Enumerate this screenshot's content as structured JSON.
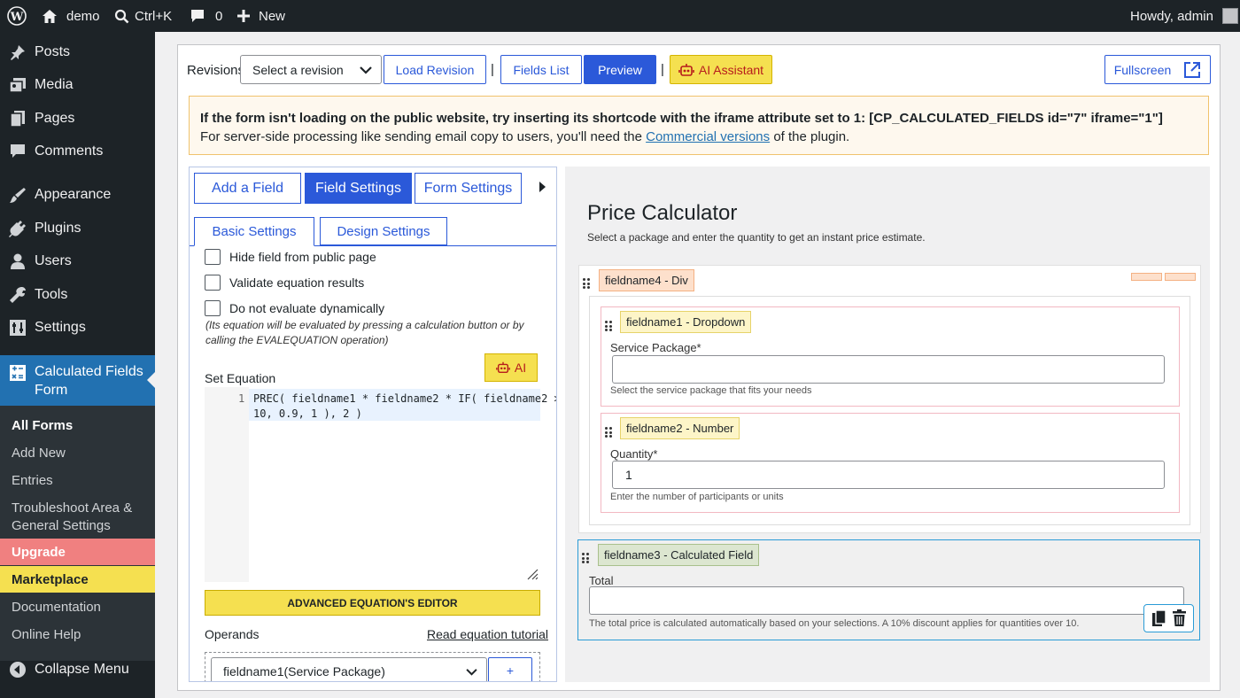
{
  "adminbar": {
    "site_name": "demo",
    "search_shortcut": "Ctrl+K",
    "comments_count": "0",
    "new_label": "New",
    "greeting": "Howdy, admin",
    "icons": [
      "wordpress-logo-icon",
      "home-icon",
      "search-icon",
      "comment-icon",
      "plus-icon",
      "avatar"
    ]
  },
  "sidebar": {
    "menu": [
      {
        "label": "Posts",
        "icon": "pushpin-icon"
      },
      {
        "label": "Media",
        "icon": "media-icon"
      },
      {
        "label": "Pages",
        "icon": "pages-icon"
      },
      {
        "label": "Comments",
        "icon": "comment-icon"
      },
      {
        "label": "Appearance",
        "icon": "brush-icon"
      },
      {
        "label": "Plugins",
        "icon": "plug-icon"
      },
      {
        "label": "Users",
        "icon": "user-icon"
      },
      {
        "label": "Tools",
        "icon": "wrench-icon"
      },
      {
        "label": "Settings",
        "icon": "sliders-icon"
      }
    ],
    "active": {
      "label_1": "Calculated Fields",
      "label_2": "Form",
      "icon": "calculator-icon"
    },
    "submenu": {
      "all_forms": "All Forms",
      "add_new": "Add New",
      "entries": "Entries",
      "troubleshoot_1": "Troubleshoot Area &",
      "troubleshoot_2": "General Settings",
      "upgrade": "Upgrade",
      "marketplace": "Marketplace",
      "documentation": "Documentation",
      "online_help": "Online Help"
    },
    "collapse": "Collapse Menu",
    "colors": {
      "active_bg": "#2271b1",
      "upgrade_bg": "#f08080",
      "marketplace_bg": "#f5e050"
    }
  },
  "toolbar": {
    "revisions_label": "Revisions",
    "revision_select": "Select a revision",
    "load_revision": "Load Revision",
    "separator": "|",
    "fields_list": "Fields List",
    "preview": "Preview",
    "ai_assistant": "AI Assistant",
    "fullscreen": "Fullscreen"
  },
  "notice": {
    "line1": "If the form isn't loading on the public website, try inserting its shortcode with the iframe attribute set to 1: [CP_CALCULATED_FIELDS id=\"7\" iframe=\"1\"]",
    "line2_before": "For server-side processing like sending email copy to users, you'll need the ",
    "line2_link": "Commercial versions",
    "line2_after": " of the plugin."
  },
  "editor": {
    "tabs": [
      "Add a Field",
      "Field Settings",
      "Form Settings"
    ],
    "subtabs": [
      "Basic Settings",
      "Design Settings"
    ],
    "hide_field": "Hide field from public page",
    "validate": "Validate equation results",
    "no_eval": "Do not evaluate dynamically",
    "no_eval_note_1": "(Its equation will be evaluated by pressing a calculation button or by",
    "no_eval_note_2": "calling the EVALEQUATION operation)",
    "ai_button": "AI",
    "set_equation": "Set Equation",
    "line_number": "1",
    "code_line_1": "PREC( fieldname1 * fieldname2 * IF( fieldname2 >",
    "code_line_2": "10, 0.9, 1 ), 2 )",
    "advanced_editor": "ADVANCED EQUATION'S EDITOR",
    "operands_label": "Operands",
    "tutorial_link": "Read equation tutorial",
    "operand_select": "fieldname1(Service Package)",
    "add_operand": "+"
  },
  "form": {
    "title": "Price Calculator",
    "description": "Select a package and enter the quantity to get an instant price estimate.",
    "div_tag": "fieldname4 - Div",
    "dropdown_tag": "fieldname1 - Dropdown",
    "dropdown_label": "Service Package*",
    "dropdown_value": "",
    "dropdown_help": "Select the service package that fits your needs",
    "number_tag": "fieldname2 - Number",
    "number_label": "Quantity*",
    "number_value": "1",
    "number_help": "Enter the number of participants or units",
    "calc_tag": "fieldname3 - Calculated Field",
    "calc_label": "Total",
    "calc_value": "",
    "calc_help": "The total price is calculated automatically based on your selections. A 10% discount applies for quantities over 10."
  }
}
